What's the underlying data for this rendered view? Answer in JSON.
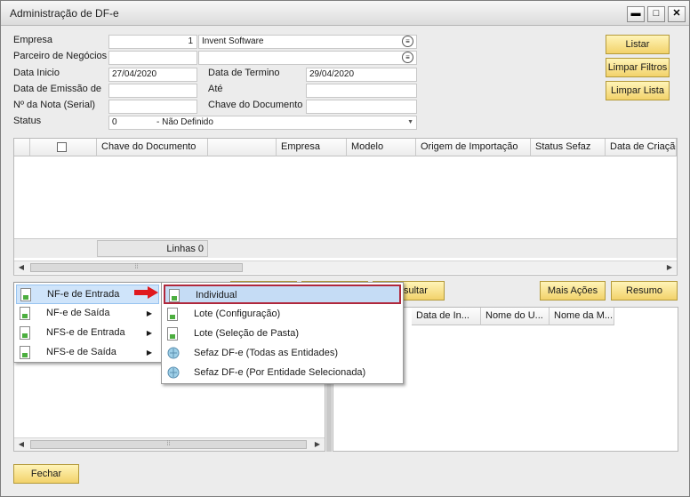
{
  "window": {
    "title": "Administração de DF-e",
    "minimize": "▬",
    "maximize": "□",
    "close": "✕"
  },
  "form": {
    "empresa_label": "Empresa",
    "empresa_code": "1",
    "empresa_name": "Invent Software",
    "parceiro_label": "Parceiro de Negócios",
    "parceiro_code": "",
    "parceiro_name": "",
    "data_inicio_label": "Data Inicio",
    "data_inicio_value": "27/04/2020",
    "data_termino_label": "Data de Termino",
    "data_termino_value": "29/04/2020",
    "data_emissao_label": "Data de Emissão de",
    "data_emissao_value": "",
    "ate_label": "Até",
    "ate_value": "",
    "num_nota_label": "Nº da Nota (Serial)",
    "num_nota_value": "",
    "chave_label": "Chave do Documento",
    "chave_value": "",
    "status_label": "Status",
    "status_code": "0",
    "status_text": "- Não Definido"
  },
  "actions": {
    "listar": "Listar",
    "limpar_filtros": "Limpar Filtros",
    "limpar_lista": "Limpar Lista"
  },
  "grid": {
    "columns": [
      "",
      "Chave do Documento",
      "",
      "Empresa",
      "Modelo",
      "Origem de Importação",
      "Status Sefaz",
      "Data de Criação"
    ],
    "footer": "Linhas 0"
  },
  "buttons_row": {
    "consultar_partial": "sultar",
    "mais_acoes": "Mais Ações",
    "resumo": "Resumo"
  },
  "lower_grid": {
    "columns": [
      "Data de In...",
      "Nome do U...",
      "Nome da M..."
    ]
  },
  "menu": {
    "items": [
      {
        "label": "NF-e de Entrada",
        "icon": "document-icon"
      },
      {
        "label": "NF-e de Saída",
        "icon": "document-icon"
      },
      {
        "label": "NFS-e de Entrada",
        "icon": "document-icon"
      },
      {
        "label": "NFS-e de Saída",
        "icon": "document-icon"
      }
    ]
  },
  "submenu": {
    "items": [
      {
        "label": "Individual",
        "icon": "document-icon"
      },
      {
        "label": "Lote (Configuração)",
        "icon": "document-icon"
      },
      {
        "label": "Lote (Seleção de Pasta)",
        "icon": "document-icon"
      },
      {
        "label": "Sefaz DF-e (Todas as Entidades)",
        "icon": "globe-icon"
      },
      {
        "label": "Sefaz DF-e (Por Entidade Selecionada)",
        "icon": "globe-icon"
      }
    ]
  },
  "footer": {
    "fechar": "Fechar"
  },
  "colors": {
    "yellow_button": "#f2d26a",
    "highlight": "#cfe4fa",
    "selection_border": "#b0283c",
    "arrow": "#e0191e"
  }
}
